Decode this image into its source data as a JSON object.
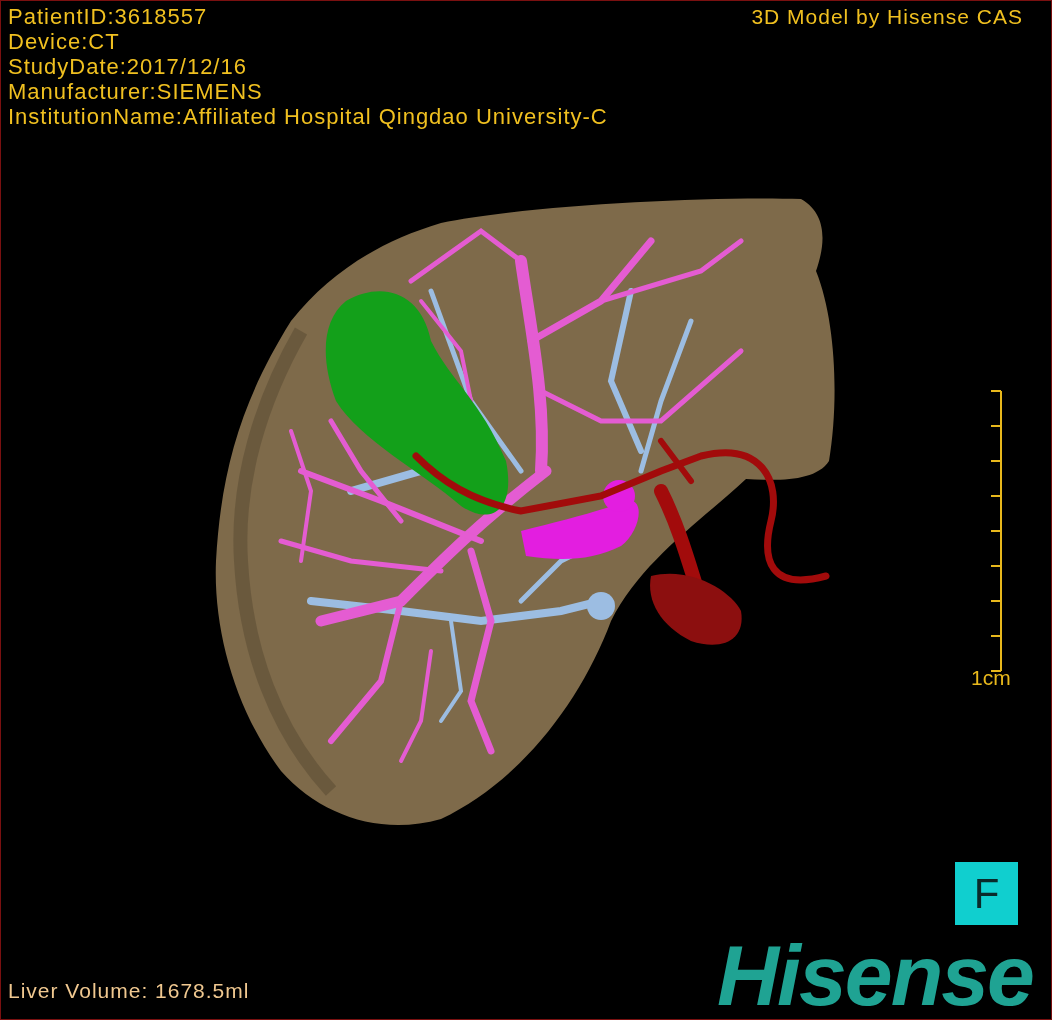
{
  "info_lines": [
    "PatientID:3618557",
    "Device:CT",
    "StudyDate:2017/12/16",
    "Manufacturer:SIEMENS",
    "InstitutionName:Affiliated Hospital Qingdao University-C"
  ],
  "title": "3D Model by Hisense CAS",
  "scale_bar": {
    "label": "1cm"
  },
  "orientation_marker": "F",
  "logo": "Hisense",
  "volume": "Liver Volume: 1678.5ml"
}
